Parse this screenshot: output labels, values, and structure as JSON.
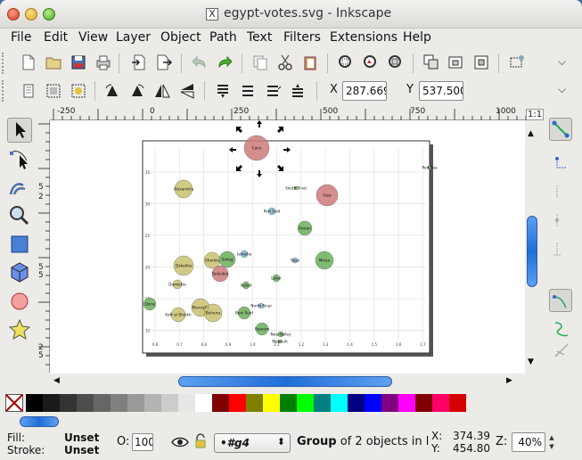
{
  "window": {
    "title": "egypt-votes.svg - Inkscape",
    "app_icon": "X"
  },
  "menubar": [
    {
      "label": "File",
      "u": "F",
      "rest": "ile"
    },
    {
      "label": "Edit",
      "u": "E",
      "rest": "dit"
    },
    {
      "label": "View",
      "u": "V",
      "rest": "iew"
    },
    {
      "label": "Layer",
      "u": "L",
      "rest": "ayer"
    },
    {
      "label": "Object",
      "u": "O",
      "rest": "bject"
    },
    {
      "label": "Path",
      "u": "P",
      "rest": "ath"
    },
    {
      "label": "Text",
      "u": "T",
      "rest": "ext"
    },
    {
      "label": "Filters",
      "u": "F",
      "rest": "ilters",
      "pre": ""
    },
    {
      "label": "Extensions",
      "u": "x",
      "pre": "E",
      "rest": "tensions"
    },
    {
      "label": "Help",
      "u": "H",
      "rest": "elp"
    }
  ],
  "controls": {
    "x_label": "X",
    "x_value": "287.669",
    "y_label": "Y",
    "y_value": "537.500"
  },
  "ruler": {
    "h_labels": [
      "-250",
      "0",
      "250",
      "500",
      "750",
      "1000"
    ],
    "v_labels": [
      "5",
      "2",
      "5",
      "5",
      "2",
      "5",
      "0"
    ],
    "zoom_btn": "1:1"
  },
  "chart": {
    "y_ticks": [
      "35",
      "30",
      "25",
      "20",
      "15",
      "10"
    ],
    "x_ticks": [
      "0.6",
      "0.7",
      "0.8",
      "0.9",
      "1.0",
      "1.1",
      "1.2",
      "1.3",
      "1.4",
      "1.5",
      "1.6",
      "1.7"
    ],
    "bubbles": [
      {
        "label": "Cairo",
        "color": "#cc7a7a"
      },
      {
        "label": "New Valley",
        "color": "#6aaf5a"
      },
      {
        "label": "Alexandria",
        "color": "#c9c16e"
      },
      {
        "label": "South Sinai",
        "color": "#6aaf5a"
      },
      {
        "label": "Giza",
        "color": "#cc7a7a"
      },
      {
        "label": "Port Said",
        "color": "#7fb8d6"
      },
      {
        "label": "Aswan",
        "color": "#6aaf5a"
      },
      {
        "label": "Dakahlia",
        "color": "#c9c16e"
      },
      {
        "label": "Sharkia",
        "color": "#c9c16e"
      },
      {
        "label": "Sohag",
        "color": "#6aaf5a"
      },
      {
        "label": "Ismailia",
        "color": "#7fb8d6"
      },
      {
        "label": "Suez",
        "color": "#7fb8d6"
      },
      {
        "label": "Minya",
        "color": "#6aaf5a"
      },
      {
        "label": "Qalyubia",
        "color": "#cc7a7a"
      },
      {
        "label": "Luxor",
        "color": "#6aaf5a"
      },
      {
        "label": "Damietta",
        "color": "#c9c16e"
      },
      {
        "label": "Assiut",
        "color": "#6aaf5a"
      },
      {
        "label": "Qena",
        "color": "#6aaf5a"
      },
      {
        "label": "Menoufia",
        "color": "#c9c16e"
      },
      {
        "label": "North Sinai",
        "color": "#7fb8d6"
      },
      {
        "label": "Kafr el-Sheikh",
        "color": "#c9c16e"
      },
      {
        "label": "Beheira",
        "color": "#c9c16e"
      },
      {
        "label": "Beni Suef",
        "color": "#6aaf5a"
      },
      {
        "label": "Fayoum",
        "color": "#6aaf5a"
      },
      {
        "label": "Red Sea",
        "color": "#6aaf5a"
      },
      {
        "label": "Matrouh",
        "color": "#6aaf5a"
      }
    ]
  },
  "palette": [
    "#000000",
    "#1a1a1a",
    "#333333",
    "#4d4d4d",
    "#666666",
    "#808080",
    "#999999",
    "#b3b3b3",
    "#cccccc",
    "#e6e6e6",
    "#ffffff",
    "#800000",
    "#ff0000",
    "#808000",
    "#ffff00",
    "#008000",
    "#00ff00",
    "#008080",
    "#00ffff",
    "#000080",
    "#0000ff",
    "#800080",
    "#ff00ff",
    "#800000",
    "#ff0066",
    "#d40000"
  ],
  "status": {
    "fill_label": "Fill:",
    "fill_value": "Unset",
    "stroke_label": "Stroke:",
    "stroke_value": "Unset",
    "opacity_label": "O:",
    "opacity_value": "100",
    "layer_value": "•#g4",
    "message_bold": "Group",
    "message_rest": " of 2 objects in l",
    "cx_label": "X:",
    "cx_value": "374.39",
    "cy_label": "Y:",
    "cy_value": "454.80",
    "zoom_label": "Z:",
    "zoom_value": "40%"
  }
}
